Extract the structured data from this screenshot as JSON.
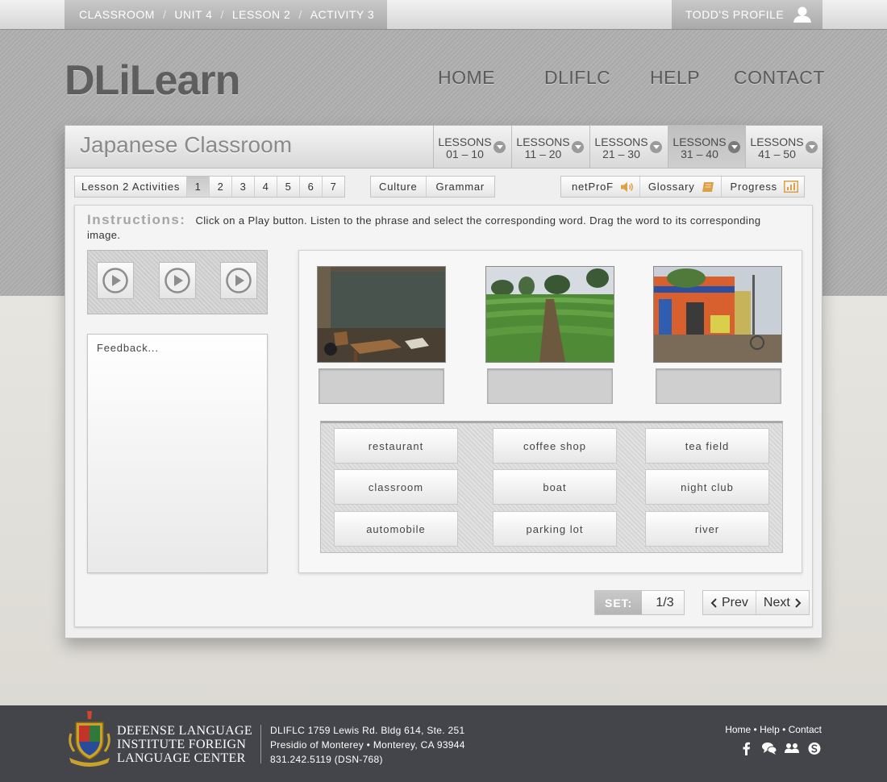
{
  "breadcrumb": [
    "CLASSROOM",
    "UNIT 4",
    "LESSON 2",
    "ACTIVITY 3"
  ],
  "breadcrumb_sep": "/",
  "profile": {
    "label": "TODD'S PROFILE",
    "icon": "user-icon"
  },
  "logo": "DLiLearn",
  "nav": [
    "HOME",
    "DLIFLC",
    "HELP",
    "CONTACT"
  ],
  "classroom_title": "Japanese Classroom",
  "lesson_tabs": [
    {
      "label": "LESSONS",
      "range": "01 – 10"
    },
    {
      "label": "LESSONS",
      "range": "11 – 20"
    },
    {
      "label": "LESSONS",
      "range": "21 – 30"
    },
    {
      "label": "LESSONS",
      "range": "31 – 40",
      "active": true
    },
    {
      "label": "LESSONS",
      "range": "41 – 50"
    }
  ],
  "activities": {
    "label": "Lesson 2 Activities",
    "numbers": [
      "1",
      "2",
      "3",
      "4",
      "5",
      "6",
      "7"
    ],
    "active": "1"
  },
  "extras": [
    "Culture",
    "Grammar"
  ],
  "tools": [
    {
      "label": "netProF",
      "icon": "speaker-icon"
    },
    {
      "label": "Glossary",
      "icon": "book-icon"
    },
    {
      "label": "Progress",
      "icon": "bar-chart-icon"
    }
  ],
  "instructions": {
    "label": "Instructions:",
    "text": "Click on  a Play button. Listen to the phrase and select the corresponding word. Drag the word to its corresponding image."
  },
  "players": [
    "play-icon",
    "play-icon",
    "play-icon"
  ],
  "feedback": "Feedback...",
  "images": [
    "classroom photo",
    "tea field photo",
    "storefront photo"
  ],
  "words": [
    "restaurant",
    "coffee shop",
    "tea field",
    "classroom",
    "boat",
    "night club",
    "automobile",
    "parking lot",
    "river"
  ],
  "set": {
    "label": "SET:",
    "value": "1/3"
  },
  "pager": {
    "prev": "Prev",
    "next": "Next"
  },
  "footer": {
    "org": [
      "DEFENSE LANGUAGE",
      "INSTITUTE FOREIGN",
      "LANGUAGE CENTER"
    ],
    "address": [
      "DLIFLC 1759 Lewis Rd. Bldg 614, Ste. 251",
      "Presidio of Monterey • Monterey, CA 93944",
      "831.242.5119 (DSN-768)"
    ],
    "links": [
      "Home",
      "Help",
      "Contact"
    ],
    "link_sep": " • ",
    "social": [
      "facebook-icon",
      "chat-icon",
      "group-icon",
      "skype-icon"
    ]
  },
  "colors": {
    "footer_bg": "#44454b",
    "tool_icon": "#d9a24a",
    "text_dark": "#333333"
  }
}
